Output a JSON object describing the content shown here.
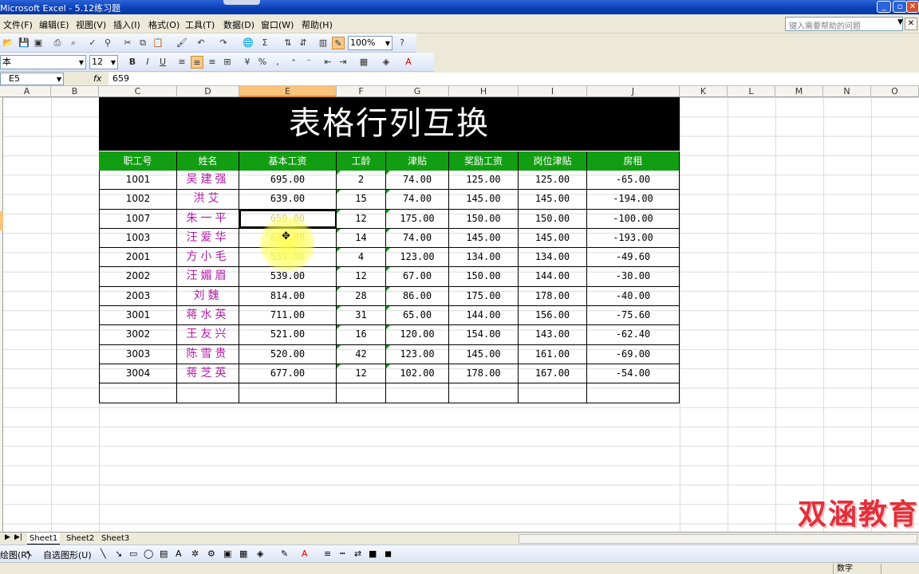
{
  "window": {
    "title": "Microsoft Excel - 5.12练习题"
  },
  "menu": {
    "items": [
      "文件(F)",
      "编辑(E)",
      "视图(V)",
      "插入(I)",
      "格式(O)",
      "工具(T)",
      "数据(D)",
      "窗口(W)",
      "帮助(H)"
    ],
    "help_placeholder": "键入需要帮助的问题"
  },
  "toolbar": {
    "zoom": "100%",
    "font_name": "本",
    "font_size": "12",
    "bold": "B",
    "italic": "I",
    "underline": "U",
    "percent": "%",
    "comma": ",",
    "sigma": "Σ"
  },
  "formula_bar": {
    "cell_ref": "E5",
    "fx": "fx",
    "value": "659"
  },
  "columns": [
    "A",
    "B",
    "C",
    "D",
    "E",
    "F",
    "G",
    "H",
    "I",
    "J",
    "K",
    "L",
    "M",
    "N",
    "O"
  ],
  "selected_column": "E",
  "sheet": {
    "title": "表格行列互换",
    "headers": [
      "职工号",
      "姓名",
      "基本工资",
      "工龄",
      "津贴",
      "奖励工资",
      "岗位津贴",
      "房租"
    ],
    "rows": [
      [
        "1001",
        "吴建强",
        "695.00",
        "2",
        "74.00",
        "125.00",
        "125.00",
        "-65.00"
      ],
      [
        "1002",
        "洪艾",
        "639.00",
        "15",
        "74.00",
        "145.00",
        "145.00",
        "-194.00"
      ],
      [
        "1007",
        "朱一平",
        "659.00",
        "12",
        "175.00",
        "150.00",
        "150.00",
        "-100.00"
      ],
      [
        "1003",
        "汪爱华",
        "639.00",
        "14",
        "74.00",
        "145.00",
        "145.00",
        "-193.00"
      ],
      [
        "2001",
        "方小毛",
        "535.00",
        "4",
        "123.00",
        "134.00",
        "134.00",
        "-49.60"
      ],
      [
        "2002",
        "汪媚眉",
        "539.00",
        "12",
        "67.00",
        "150.00",
        "144.00",
        "-30.00"
      ],
      [
        "2003",
        "刘魏",
        "814.00",
        "28",
        "86.00",
        "175.00",
        "178.00",
        "-40.00"
      ],
      [
        "3001",
        "蒋水英",
        "711.00",
        "31",
        "65.00",
        "144.00",
        "156.00",
        "-75.60"
      ],
      [
        "3002",
        "王友兴",
        "521.00",
        "16",
        "120.00",
        "154.00",
        "143.00",
        "-62.40"
      ],
      [
        "3003",
        "陈雪贵",
        "520.00",
        "42",
        "123.00",
        "145.00",
        "161.00",
        "-69.00"
      ],
      [
        "3004",
        "蒋芝英",
        "677.00",
        "12",
        "102.00",
        "178.00",
        "167.00",
        "-54.00"
      ]
    ]
  },
  "sheet_tabs": [
    "Sheet1",
    "Sheet2",
    "Sheet3"
  ],
  "active_tab": "Sheet1",
  "draw_toolbar": {
    "draw_label": "绘图(R)",
    "autoshape_label": "自选图形(U)"
  },
  "status": {
    "mode": "数字"
  },
  "watermark": "双涵教育",
  "colors": {
    "title_bg": "#000000",
    "header_bg": "#129e12",
    "name_text": "#b21aa8",
    "watermark": "#e0313b"
  }
}
